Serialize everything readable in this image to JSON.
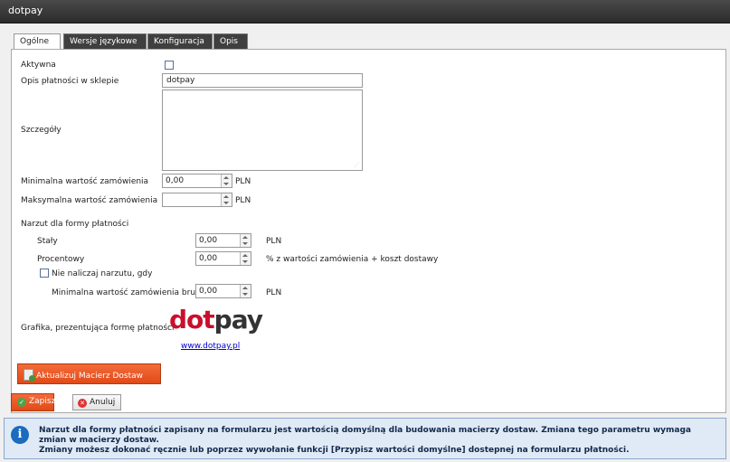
{
  "window": {
    "title": "dotpay"
  },
  "tabs": [
    {
      "label": "Ogólne"
    },
    {
      "label": "Wersje językowe"
    },
    {
      "label": "Konfiguracja"
    },
    {
      "label": "Opis"
    }
  ],
  "form": {
    "active_label": "Aktywna",
    "description_label": "Opis płatności w sklepie",
    "description_value": "dotpay",
    "details_label": "Szczegóły",
    "details_value": "",
    "min_order_label": "Minimalna wartość zamówienia",
    "min_order_value": "0,00",
    "max_order_label": "Maksymalna wartość zamówienia",
    "max_order_value": "",
    "currency": "PLN",
    "surcharge_header": "Narzut dla formy płatności",
    "fixed_label": "Stały",
    "fixed_value": "0,00",
    "percent_label": "Procentowy",
    "percent_value": "0,00",
    "percent_suffix": "% z wartości zamówienia + koszt dostawy",
    "no_surcharge_label": "Nie naliczaj narzutu, gdy",
    "min_gross_label": "Minimalna wartość zamówienia brutto",
    "min_gross_value": "0,00",
    "graphic_label": "Grafika, prezentująca formę płatności",
    "logo_part1": "dot",
    "logo_part2": "pay",
    "website_link": "www.dotpay.pl",
    "update_matrix_button": "Aktualizuj Macierz Dostaw"
  },
  "buttons": {
    "save": "Zapisz",
    "cancel": "Anuluj"
  },
  "info": {
    "line1": "Narzut dla formy płatności zapisany na formularzu jest wartością domyślną dla budowania macierzy dostaw. Zmiana tego parametru wymaga zmian w macierzy dostaw.",
    "line2": "Zmiany możesz dokonać ręcznie lub poprzez wywołanie funkcji [Przypisz wartości domyślne] dostepnej na formularzu płatności."
  },
  "colors": {
    "accent_orange": "#e8521f",
    "info_blue": "#1b6bbf",
    "logo_red": "#c8102e"
  }
}
